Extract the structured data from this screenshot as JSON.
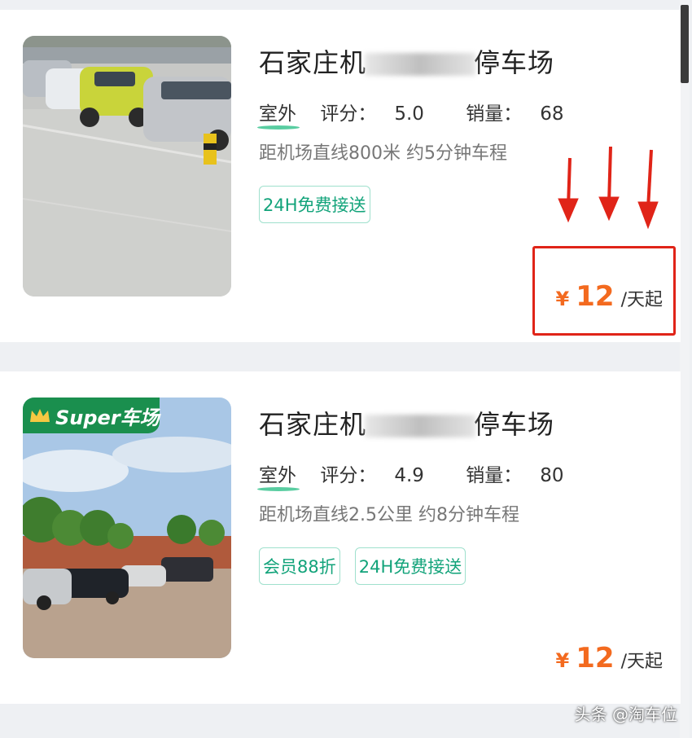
{
  "listings": [
    {
      "title_prefix": "石家庄机",
      "title_suffix": "停车场",
      "tag_outdoor": "室外",
      "rating_label": "评分：",
      "rating": "5.0",
      "sales_label": "销量：",
      "sales": "68",
      "distance": "距机场直线800米 约5分钟车程",
      "tags": [
        "24H免费接送"
      ],
      "currency": "¥",
      "price": "12",
      "price_unit": "/天起"
    },
    {
      "badge": "Super车场",
      "title_prefix": "石家庄机",
      "title_suffix": "停车场",
      "tag_outdoor": "室外",
      "rating_label": "评分：",
      "rating": "4.9",
      "sales_label": "销量：",
      "sales": "80",
      "distance": "距机场直线2.5公里 约8分钟车程",
      "tags": [
        "会员88折",
        "24H免费接送"
      ],
      "currency": "¥",
      "price": "12",
      "price_unit": "/天起"
    }
  ],
  "watermark": "头条 @淘车位",
  "colors": {
    "accent_green": "#12a37a",
    "price_orange": "#f36a1f",
    "annotation_red": "#e02418",
    "badge_green": "#1a8f4e"
  }
}
